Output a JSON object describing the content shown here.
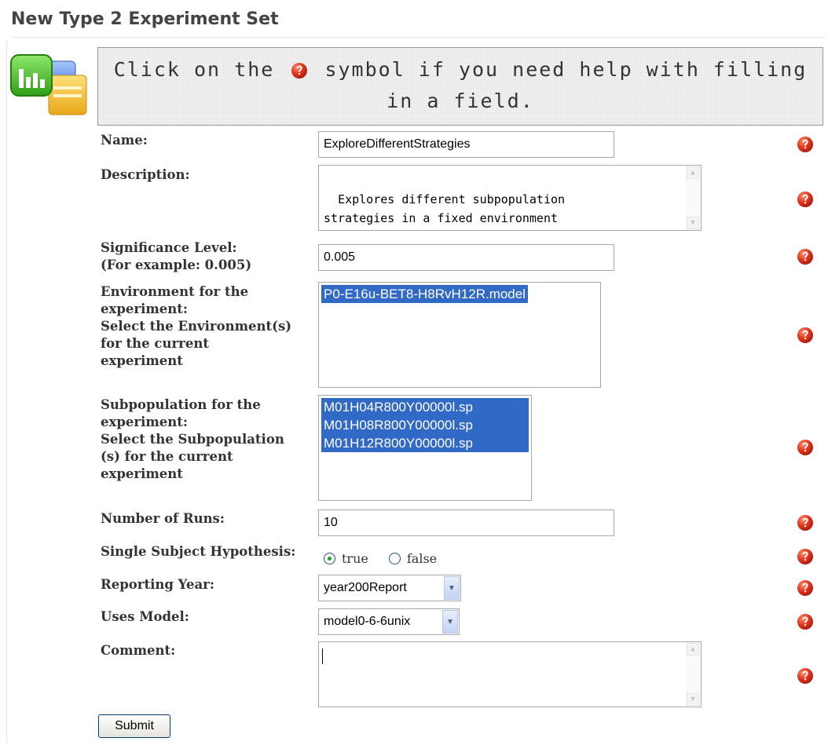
{
  "page": {
    "title": "New Type 2 Experiment Set",
    "help_text_before": "Click on the",
    "help_text_after": "symbol if you need help with filling in a field."
  },
  "form": {
    "name": {
      "label": "Name:",
      "value": "ExploreDifferentStrategies"
    },
    "description": {
      "label": "Description:",
      "value": "Explores different subpopulation\nstrategies in a fixed environment"
    },
    "significance": {
      "label_line1": "Significance Level:",
      "label_line2": "(For example: 0.005)",
      "value": "0.005"
    },
    "environment": {
      "label_line1": "Environment for the",
      "label_line2": "experiment:",
      "label_line3": "Select the Environment(s)",
      "label_line4": "for the current",
      "label_line5": "experiment",
      "options": [
        "P0-E16u-BET8-H8RvH12R.model"
      ]
    },
    "subpopulation": {
      "label_line1": "Subpopulation for the",
      "label_line2": "experiment:",
      "label_line3": "Select the Subpopulation",
      "label_line4": "(s) for the current",
      "label_line5": "experiment",
      "options": [
        "M01H04R800Y00000l.sp",
        "M01H08R800Y00000l.sp",
        "M01H12R800Y00000l.sp"
      ]
    },
    "runs": {
      "label": "Number of Runs:",
      "value": "10"
    },
    "hypothesis": {
      "label": "Single Subject Hypothesis:",
      "option_true": "true",
      "option_false": "false",
      "selected": "true"
    },
    "reporting_year": {
      "label": "Reporting Year:",
      "value": "year200Report"
    },
    "uses_model": {
      "label": "Uses Model:",
      "value": "model0-6-6unix"
    },
    "comment": {
      "label": "Comment:",
      "value": ""
    },
    "submit_label": "Submit"
  },
  "colors": {
    "selection": "#3169c6",
    "help_icon": "#d8301c",
    "radio_dot": "#21a121"
  },
  "icons": {
    "help": "question-mark-help-icon",
    "logo": "chart-folder-icon"
  }
}
